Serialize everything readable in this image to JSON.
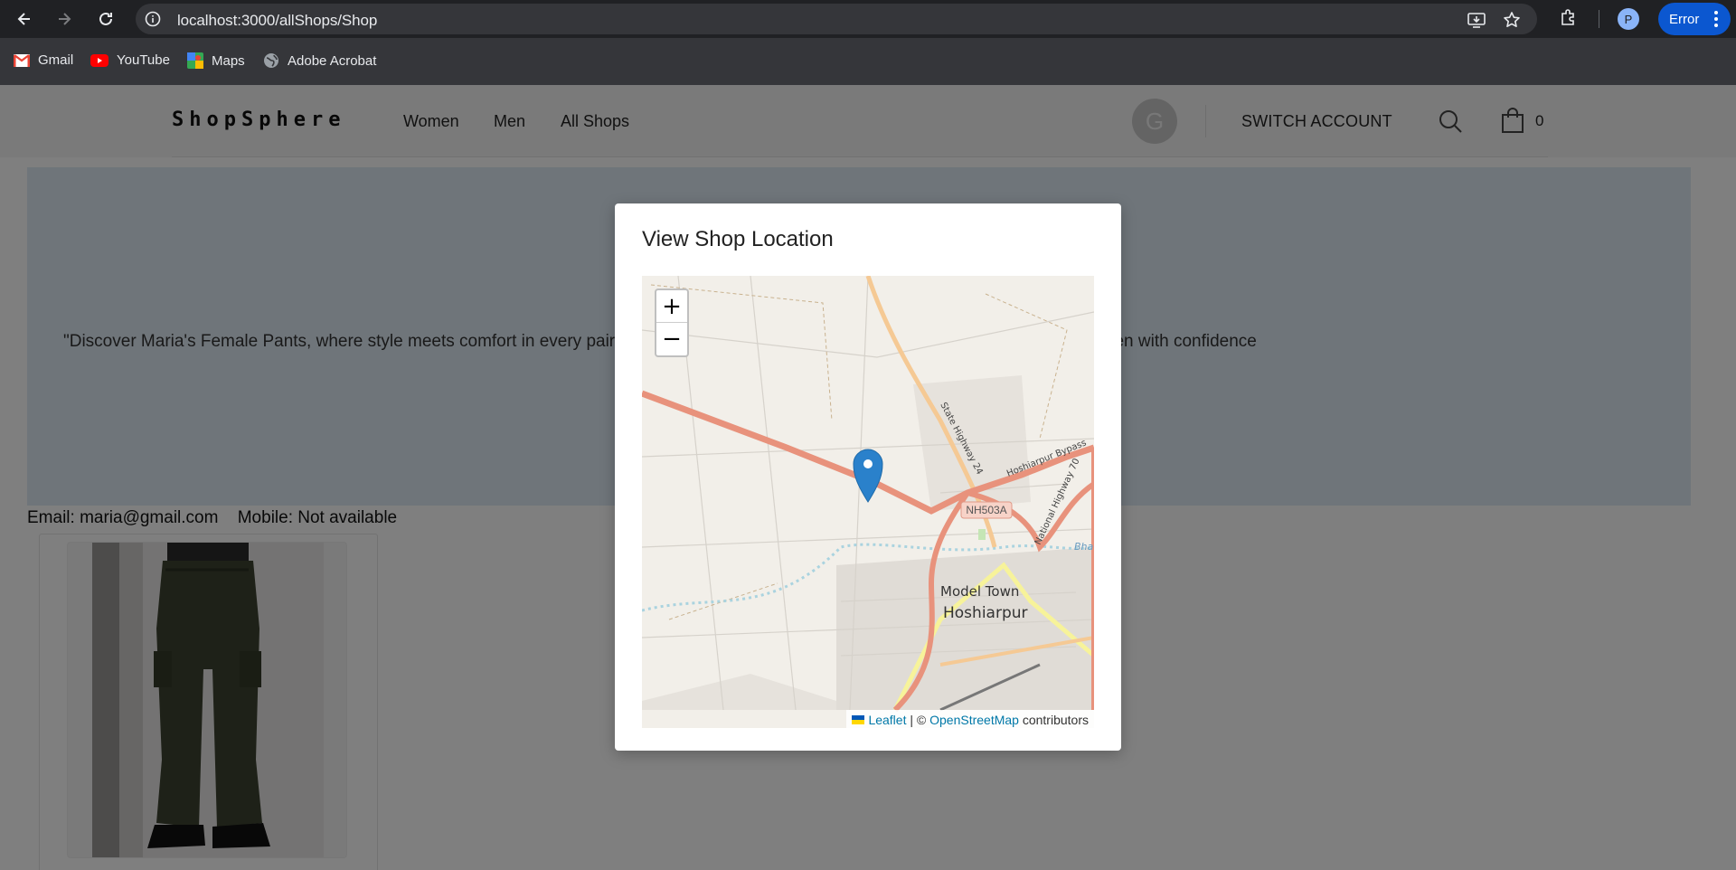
{
  "browser": {
    "url": "localhost:3000/allShops/Shop",
    "profile_initial": "P",
    "error_label": "Error"
  },
  "bookmarks": [
    {
      "label": "Gmail",
      "icon": "gmail-icon"
    },
    {
      "label": "YouTube",
      "icon": "youtube-icon"
    },
    {
      "label": "Maps",
      "icon": "maps-icon"
    },
    {
      "label": "Adobe Acrobat",
      "icon": "globe-icon"
    }
  ],
  "header": {
    "brand": "ShopSphere",
    "nav": [
      "Women",
      "Men",
      "All Shops"
    ],
    "avatar_initial": "G",
    "switch_account": "SWITCH ACCOUNT",
    "cart_count": "0"
  },
  "shop": {
    "description": "\"Discover Maria's Female Pants, where style meets comfort in every pair. Our pants are designed to flatter every figure and empower women with confidence",
    "email": "Email: maria@gmail.com",
    "mobile": "Mobile: Not available"
  },
  "modal": {
    "title": "View Shop Location",
    "zoom_in": "+",
    "zoom_out": "−",
    "map_labels": {
      "road_shield": "NH503A",
      "neighborhood": "Model Town",
      "city": "Hoshiarpur",
      "highway1": "State Highway 24",
      "highway2": "Hoshiarpur Bypass",
      "highway3": "National Highway 70",
      "water": "Bha"
    },
    "attribution": {
      "leaflet": "Leaflet",
      "sep": " | © ",
      "osm": "OpenStreetMap",
      "suffix": " contributors"
    }
  },
  "colors": {
    "overlay": "rgba(0,0,0,0.5)",
    "banner": "#dfeaf5",
    "marker": "#2a81cb",
    "chrome": "#202124",
    "error_pill": "#0b57d0"
  }
}
